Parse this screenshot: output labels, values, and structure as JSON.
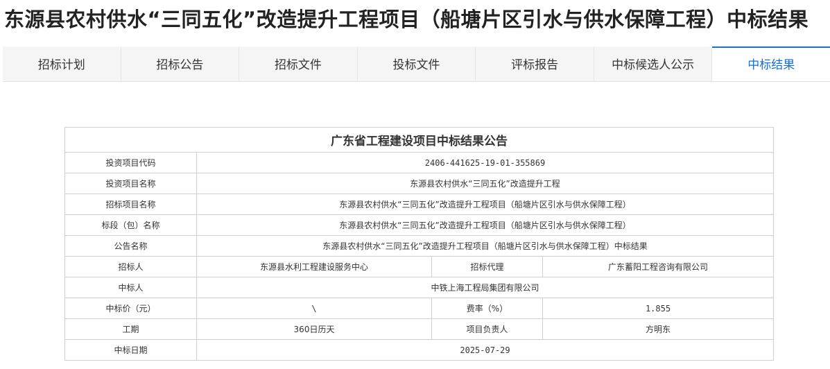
{
  "page": {
    "title": "东源县农村供水“三同五化”改造提升工程项目（船塘片区引水与供水保障工程）中标结果"
  },
  "tabs": [
    {
      "label": "招标计划",
      "active": false
    },
    {
      "label": "招标公告",
      "active": false
    },
    {
      "label": "招标文件",
      "active": false
    },
    {
      "label": "投标文件",
      "active": false
    },
    {
      "label": "评标报告",
      "active": false
    },
    {
      "label": "中标候选人公示",
      "active": false
    },
    {
      "label": "中标结果",
      "active": true
    }
  ],
  "colors": {
    "accent": "#1a6fc9",
    "tab_bg": "#f5f5f5",
    "border": "#cfcfcf"
  },
  "notice": {
    "caption": "广东省工程建设项目中标结果公告",
    "project_code_label": "投资项目代码",
    "project_code": "2406-441625-19-01-355869",
    "project_name_label": "投资项目名称",
    "project_name": "东源县农村供水“三同五化”改造提升工程",
    "tender_project_label": "招标项目名称",
    "tender_project": "东源县农村供水“三同五化”改造提升工程项目（船塘片区引水与供水保障工程）",
    "section_label": "标段（包）名称",
    "section": "东源县农村供水“三同五化”改造提升工程项目（船塘片区引水与供水保障工程）",
    "announcement_label": "公告名称",
    "announcement": "东源县农村供水“三同五化”改造提升工程项目（船塘片区引水与供水保障工程）中标结果",
    "tenderer_label": "招标人",
    "tenderer": "东源县水利工程建设服务中心",
    "agent_label": "招标代理",
    "agent": "广东蓄阳工程咨询有限公司",
    "winner_label": "中标人",
    "winner": "中铁上海工程局集团有限公司",
    "price_label": "中标价（元）",
    "price": "\\",
    "rate_label": "费率（%）",
    "rate": "1.855",
    "period_label": "工期",
    "period": "360日历天",
    "manager_label": "项目负责人",
    "manager": "方明东",
    "date_label": "中标日期",
    "date": "2025-07-29"
  }
}
